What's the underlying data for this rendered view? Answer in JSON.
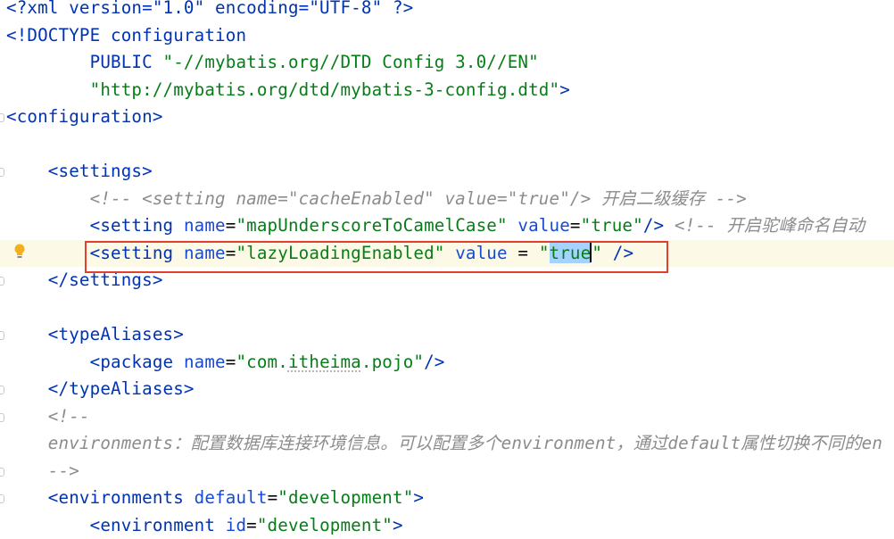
{
  "editor": {
    "lines": [
      {
        "segments": [
          {
            "t": "<?xml version=\"1.0\" encoding=\"UTF-8\" ?>",
            "c": "t-doctype"
          }
        ]
      },
      {
        "segments": [
          {
            "t": "<!DOCTYPE configuration",
            "c": "t-doctype"
          }
        ]
      },
      {
        "segments": [
          {
            "t": "        PUBLIC ",
            "c": "t-doctype"
          },
          {
            "t": "\"-//mybatis.org//DTD Config 3.0//EN\"",
            "c": "t-val"
          }
        ]
      },
      {
        "segments": [
          {
            "t": "        ",
            "c": "t-text"
          },
          {
            "t": "\"http://mybatis.org/dtd/mybatis-3-config.dtd\"",
            "c": "t-val"
          },
          {
            "t": ">",
            "c": "t-doctype"
          }
        ]
      },
      {
        "segments": [
          {
            "t": "<configuration>",
            "c": "t-tag"
          }
        ]
      },
      {
        "segments": []
      },
      {
        "segments": [
          {
            "t": "    <settings>",
            "c": "t-tag"
          }
        ]
      },
      {
        "segments": [
          {
            "t": "        <!-- <setting name=\"cacheEnabled\" value=\"true\"/> 开启二级缓存 -->",
            "c": "t-comment"
          }
        ]
      },
      {
        "segments": [
          {
            "t": "        <setting ",
            "c": "t-tag"
          },
          {
            "t": "name",
            "c": "t-attr"
          },
          {
            "t": "=",
            "c": "t-text"
          },
          {
            "t": "\"mapUnderscoreToCamelCase\"",
            "c": "t-val"
          },
          {
            "t": " ",
            "c": "t-text"
          },
          {
            "t": "value",
            "c": "t-attr"
          },
          {
            "t": "=",
            "c": "t-text"
          },
          {
            "t": "\"true\"",
            "c": "t-val"
          },
          {
            "t": "/>",
            "c": "t-tag"
          },
          {
            "t": " <!-- 开启驼峰命名自动",
            "c": "t-comment"
          }
        ]
      },
      {
        "segments": [
          {
            "t": "        <setting ",
            "c": "t-tag"
          },
          {
            "t": "name",
            "c": "t-attr"
          },
          {
            "t": "=",
            "c": "t-text"
          },
          {
            "t": "\"lazyLoadingEnabled\"",
            "c": "t-val"
          },
          {
            "t": " ",
            "c": "t-text"
          },
          {
            "t": "value",
            "c": "t-attr"
          },
          {
            "t": " = ",
            "c": "t-text"
          },
          {
            "t": "\"",
            "c": "t-val"
          },
          {
            "t": "true",
            "c": "t-val sel"
          },
          {
            "t": "",
            "c": "caret"
          },
          {
            "t": "\"",
            "c": "t-val"
          },
          {
            "t": " />",
            "c": "t-tag"
          }
        ],
        "highlight": true
      },
      {
        "segments": [
          {
            "t": "    </settings>",
            "c": "t-tag"
          }
        ]
      },
      {
        "segments": []
      },
      {
        "segments": [
          {
            "t": "    <typeAliases>",
            "c": "t-tag"
          }
        ]
      },
      {
        "segments": [
          {
            "t": "        <package ",
            "c": "t-tag"
          },
          {
            "t": "name",
            "c": "t-attr"
          },
          {
            "t": "=",
            "c": "t-text"
          },
          {
            "t": "\"com.",
            "c": "t-val"
          },
          {
            "t": "itheima",
            "c": "t-val wavy"
          },
          {
            "t": ".pojo\"",
            "c": "t-val"
          },
          {
            "t": "/>",
            "c": "t-tag"
          }
        ]
      },
      {
        "segments": [
          {
            "t": "    </typeAliases>",
            "c": "t-tag"
          }
        ]
      },
      {
        "segments": [
          {
            "t": "    <!--",
            "c": "t-comment"
          }
        ]
      },
      {
        "segments": [
          {
            "t": "    environments：配置数据库连接环境信息。可以配置多个environment，通过default属性切换不同的en",
            "c": "t-comment"
          }
        ]
      },
      {
        "segments": [
          {
            "t": "    -->",
            "c": "t-comment"
          }
        ]
      },
      {
        "segments": [
          {
            "t": "    <environments ",
            "c": "t-tag"
          },
          {
            "t": "default",
            "c": "t-attr"
          },
          {
            "t": "=",
            "c": "t-text"
          },
          {
            "t": "\"development\"",
            "c": "t-val"
          },
          {
            "t": ">",
            "c": "t-tag"
          }
        ]
      },
      {
        "segments": [
          {
            "t": "        <environment ",
            "c": "t-tag"
          },
          {
            "t": "id",
            "c": "t-attr"
          },
          {
            "t": "=",
            "c": "t-text"
          },
          {
            "t": "\"development\"",
            "c": "t-val"
          },
          {
            "t": ">",
            "c": "t-tag"
          }
        ]
      }
    ]
  },
  "gutter": {
    "fold_marks": [
      4,
      6,
      10,
      12,
      14,
      15,
      17,
      18
    ],
    "bulb_icon": "lightbulb-icon"
  },
  "colors": {
    "highlight_box": "#e2402f",
    "selection": "#a6d2ff",
    "bulb": "#f2b01e"
  }
}
